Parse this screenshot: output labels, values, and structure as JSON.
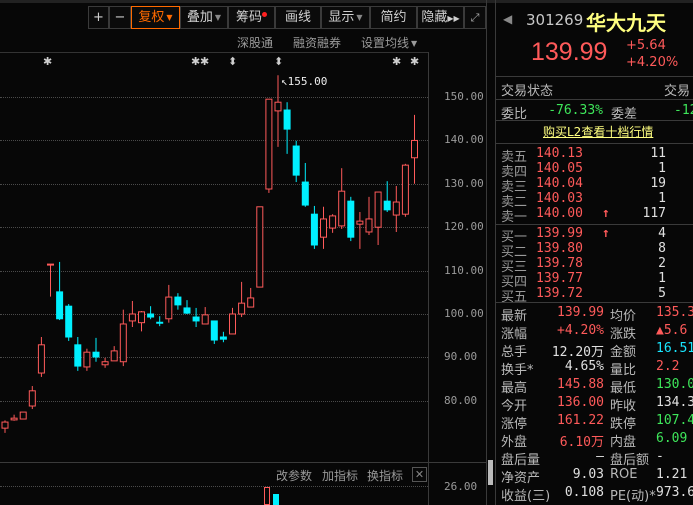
{
  "toolbar": {
    "plus": "+",
    "minus": "−",
    "fuquan": "复权",
    "diejia": "叠加",
    "chouma": "筹码",
    "huaxian": "画线",
    "xianshi": "显示",
    "jianyue": "简约",
    "yincang": "隐藏"
  },
  "subbar": {
    "sgt": "深股通",
    "rzrq": "融资融券",
    "ma": "设置均线"
  },
  "chart": {
    "high_label": "155.00",
    "price_labels": [
      "150.00",
      "140.00",
      "130.00",
      "120.00",
      "110.00",
      "100.00",
      "90.00",
      "80.00"
    ],
    "price_values": [
      150,
      140,
      130,
      120,
      110,
      100,
      90,
      80
    ],
    "candles": [
      [
        73.7,
        75.5,
        72.6,
        75.1
      ],
      [
        75.6,
        76.8,
        75.4,
        76.0
      ],
      [
        75.8,
        77.4,
        75.8,
        77.4
      ],
      [
        78.8,
        83.4,
        78.1,
        82.3
      ],
      [
        86.4,
        94.7,
        85.5,
        92.9
      ],
      [
        111.3,
        111.5,
        104,
        111.5
      ],
      [
        105.1,
        112,
        98.6,
        98.9
      ],
      [
        101.8,
        102.3,
        93.8,
        94.7
      ],
      [
        92.9,
        94.7,
        86.9,
        88.0
      ],
      [
        87.8,
        92,
        86.9,
        91.2
      ],
      [
        91.2,
        94.5,
        89,
        90.1
      ],
      [
        88.3,
        89.9,
        87.6,
        89.0
      ],
      [
        89.2,
        92.6,
        89.2,
        91.5
      ],
      [
        89.0,
        101,
        88,
        97.7
      ],
      [
        98.4,
        103,
        97,
        100
      ],
      [
        98,
        100.7,
        96,
        100.5
      ],
      [
        100,
        101.8,
        98.8,
        99.3
      ],
      [
        98.1,
        99.5,
        97.2,
        97.9
      ],
      [
        98.9,
        106.7,
        98,
        103.9
      ],
      [
        103.9,
        104.8,
        101,
        102.1
      ],
      [
        101.4,
        103.2,
        100,
        100.2
      ],
      [
        99.3,
        101.4,
        97,
        98.4
      ],
      [
        97.7,
        101.6,
        97.7,
        99.8
      ],
      [
        98.4,
        98.4,
        93.1,
        94
      ],
      [
        94.7,
        95.9,
        93.5,
        94.2
      ],
      [
        95.4,
        101.4,
        95.4,
        100
      ],
      [
        100,
        107.4,
        99.3,
        102.5
      ],
      [
        101.6,
        106,
        101.6,
        103.7
      ],
      [
        106.2,
        124.7,
        106.2,
        124.7
      ],
      [
        128.8,
        149.5,
        127.9,
        149.5
      ],
      [
        146.8,
        155,
        138.5,
        148.8
      ],
      [
        147,
        148.8,
        136.9,
        142.6
      ],
      [
        138.7,
        139.9,
        130.4,
        132
      ],
      [
        130.4,
        134.8,
        124.7,
        125.1
      ],
      [
        123,
        124.9,
        115,
        115.9
      ],
      [
        117.7,
        124.7,
        115,
        121.9
      ],
      [
        119.8,
        123,
        118.7,
        122.6
      ],
      [
        120.3,
        133.6,
        119.6,
        128.3
      ],
      [
        126,
        127,
        116.8,
        117.7
      ],
      [
        120.7,
        123.5,
        115,
        121.4
      ],
      [
        118.9,
        127,
        118.2,
        121.9
      ],
      [
        120,
        128.1,
        115.9,
        128.1
      ],
      [
        126,
        130.6,
        123.5,
        124
      ],
      [
        122.8,
        129.5,
        118.9,
        125.8
      ],
      [
        123,
        134.6,
        122.4,
        134.3
      ],
      [
        136,
        145.88,
        130,
        139.99
      ]
    ],
    "volume_label": "26.00"
  },
  "indicator_bar": {
    "params": "改参数",
    "add": "加指标",
    "change": "换指标"
  },
  "quote": {
    "code": "301269",
    "name": "华大九天",
    "price": "139.99",
    "change": "+5.64",
    "pct": "+4.20%",
    "status_label": "交易状态",
    "status_value": "交易",
    "wb_label": "委比",
    "wb_value": "-76.33%",
    "wc_label": "委差",
    "wc_value": "-12",
    "l2_link": "购买L2查看十档行情",
    "asks": [
      {
        "label": "卖五",
        "price": "140.13",
        "vol": "11"
      },
      {
        "label": "卖四",
        "price": "140.05",
        "vol": "1"
      },
      {
        "label": "卖三",
        "price": "140.04",
        "vol": "19"
      },
      {
        "label": "卖二",
        "price": "140.03",
        "vol": "1"
      },
      {
        "label": "卖一",
        "price": "140.00",
        "vol": "117",
        "arrow": "↑"
      }
    ],
    "bids": [
      {
        "label": "买一",
        "price": "139.99",
        "vol": "4",
        "arrow": "↑"
      },
      {
        "label": "买二",
        "price": "139.80",
        "vol": "8"
      },
      {
        "label": "买三",
        "price": "139.78",
        "vol": "2"
      },
      {
        "label": "买四",
        "price": "139.77",
        "vol": "1"
      },
      {
        "label": "买五",
        "price": "139.72",
        "vol": "5"
      }
    ],
    "stats": [
      {
        "l1": "最新",
        "v1": "139.99",
        "c1": "red",
        "l2": "均价",
        "v2": "135.3",
        "c2": "red"
      },
      {
        "l1": "涨幅",
        "v1": "+4.20%",
        "c1": "red",
        "l2": "涨跌",
        "v2": "▲5.6",
        "c2": "red"
      },
      {
        "l1": "总手",
        "v1": "12.20万",
        "c1": "wht",
        "l2": "金额",
        "v2": "16.51",
        "c2": "cyn"
      },
      {
        "l1": "换手*",
        "v1": "4.65%",
        "c1": "wht",
        "l2": "量比",
        "v2": "2.2",
        "c2": "red"
      },
      {
        "l1": "最高",
        "v1": "145.88",
        "c1": "red",
        "l2": "最低",
        "v2": "130.0",
        "c2": "grn"
      },
      {
        "l1": "今开",
        "v1": "136.00",
        "c1": "red",
        "l2": "昨收",
        "v2": "134.3",
        "c2": "wht"
      },
      {
        "l1": "涨停",
        "v1": "161.22",
        "c1": "red",
        "l2": "跌停",
        "v2": "107.4",
        "c2": "grn"
      },
      {
        "l1": "外盘",
        "v1": "6.10万",
        "c1": "red",
        "l2": "内盘",
        "v2": "6.09",
        "c2": "grn"
      },
      {
        "l1": "盘后量",
        "v1": "—",
        "c1": "wht",
        "l2": "盘后额",
        "v2": "-",
        "c2": "wht"
      },
      {
        "l1": "净资产",
        "v1": "9.03",
        "c1": "wht",
        "l2": "ROE",
        "v2": "1.21",
        "c2": "wht"
      },
      {
        "l1": "收益(三)",
        "v1": "0.108",
        "c1": "wht",
        "l2": "PE(动)*",
        "v2": "973.6",
        "c2": "wht"
      }
    ]
  },
  "colors": {
    "up": "#ff5a5a",
    "down": "#00f0ff",
    "accent": "#ff6a00"
  }
}
